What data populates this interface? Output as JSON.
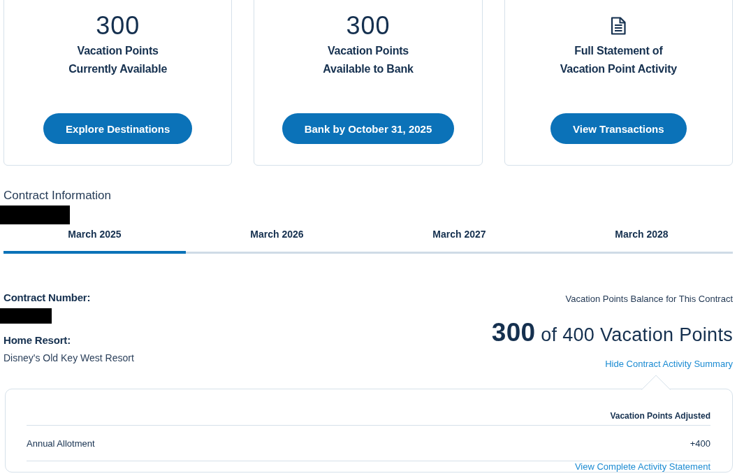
{
  "summary_cards": [
    {
      "kind": "figure",
      "figure": "300",
      "label": "Vacation Points\nCurrently Available",
      "button": "Explore Destinations"
    },
    {
      "kind": "figure",
      "figure": "300",
      "label": "Vacation Points\nAvailable to Bank",
      "button": "Bank by October 31, 2025"
    },
    {
      "kind": "document",
      "label": "Full Statement of\nVacation Point Activity",
      "button": "View Transactions"
    }
  ],
  "contract": {
    "heading": "Contract Information",
    "name_redacted": true,
    "tabs": [
      {
        "label": "March 2025",
        "selected": true
      },
      {
        "label": "March 2026",
        "selected": false
      },
      {
        "label": "March 2027",
        "selected": false
      },
      {
        "label": "March 2028",
        "selected": false
      }
    ],
    "details": [
      {
        "label": "Contract Number:",
        "value_redacted": true
      },
      {
        "label": "Home Resort:",
        "value": "Disney's Old Key West Resort",
        "value_redacted": false
      }
    ],
    "balance": {
      "caption": "Vacation Points Balance for This Contract",
      "total": "**300** of 400 Vacation Points",
      "toggle_link": "Hide Contract Activity Summary"
    },
    "activity_summary": {
      "column_header": "Vacation Points Adjusted",
      "rows": [
        {
          "description": "Annual Allotment",
          "points": "+400"
        }
      ],
      "footer_link": "View Complete Activity Statement"
    }
  }
}
